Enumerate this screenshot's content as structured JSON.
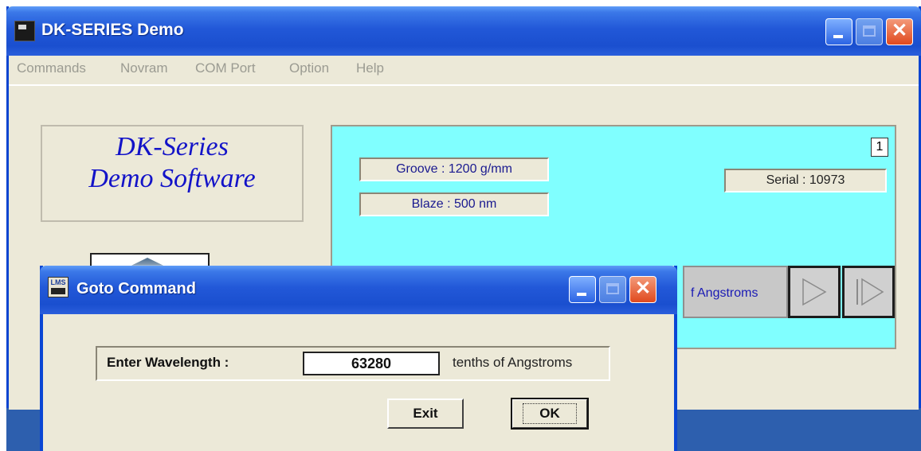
{
  "main_window": {
    "title": "DK-SERIES Demo",
    "menu": [
      "Commands",
      "Novram",
      "COM Port",
      "Option",
      "Help"
    ],
    "logo_line1": "DK-Series",
    "logo_line2": "Demo Software",
    "info": {
      "groove": "Groove : 1200 g/mm",
      "blaze": "Blaze : 500 nm",
      "serial": "Serial : 10973",
      "corner_number": "1"
    },
    "step_unit_label": "f Angstroms"
  },
  "dialog": {
    "title": "Goto Command",
    "icon_text": "LMS",
    "wavelength_label": "Enter Wavelength :",
    "wavelength_value": "63280",
    "unit_label": "tenths of Angstroms",
    "exit_label": "Exit",
    "ok_label": "OK"
  },
  "colors": {
    "title_blue": "#2258d8",
    "panel_cyan": "#80ffff",
    "logo_text": "#1313c8",
    "close_red": "#e0491e"
  },
  "icons": {
    "main_window": "app-icon",
    "dialog": "lms-icon",
    "step_forward": "play-icon",
    "step_end": "skip-forward-icon"
  }
}
